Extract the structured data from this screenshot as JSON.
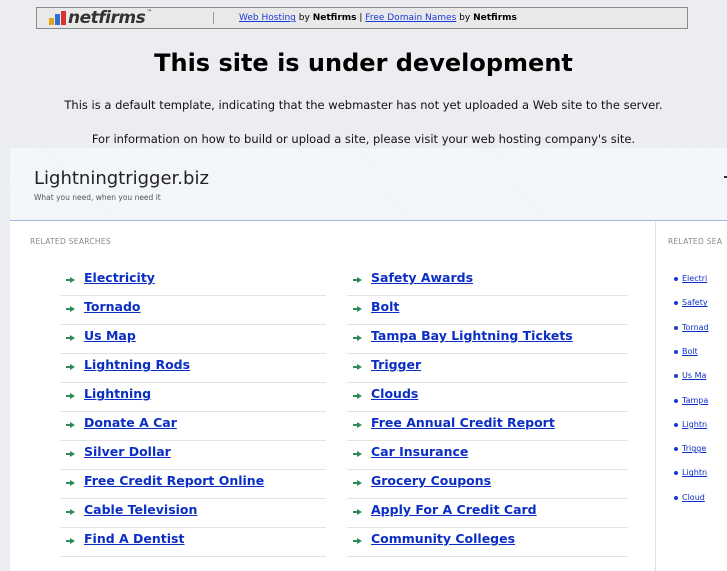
{
  "topbar": {
    "brand": "netfirms",
    "link1": "Web Hosting",
    "by1": "by",
    "brand1": "Netfirms",
    "sep": "|",
    "link2": "Free Domain Names",
    "by2": "by",
    "brand2": "Netfirms"
  },
  "notice": {
    "title": "This site is under development",
    "line1": "This is a default template, indicating that the webmaster has not yet uploaded a Web site to the server.",
    "line2": "For information on how to build or upload a site, please visit your web hosting company's site."
  },
  "site": {
    "name": "Lightningtrigger.biz",
    "tagline": "What you need, when you need it"
  },
  "main": {
    "label": "RELATED SEARCHES",
    "col1": [
      "Electricity",
      "Tornado",
      "Us Map",
      "Lightning Rods",
      "Lightning",
      "Donate A Car",
      "Silver Dollar",
      "Free Credit Report Online",
      "Cable Television",
      "Find A Dentist"
    ],
    "col2": [
      "Safety Awards",
      "Bolt",
      "Tampa Bay Lightning Tickets",
      "Trigger",
      "Clouds",
      "Free Annual Credit Report",
      "Car Insurance",
      "Grocery Coupons",
      "Apply For A Credit Card",
      "Community Colleges"
    ]
  },
  "side": {
    "label": "RELATED SEA",
    "items": [
      "Electri",
      "Safety",
      "Tornad",
      "Bolt",
      "Us Ma",
      "Tampa",
      "Lightn",
      "Trigge",
      "Lightn",
      "Cloud"
    ]
  },
  "colors": {
    "link": "#0b2ec4",
    "arrow": "#2e8b57",
    "panel_border": "#9fb6e3"
  }
}
